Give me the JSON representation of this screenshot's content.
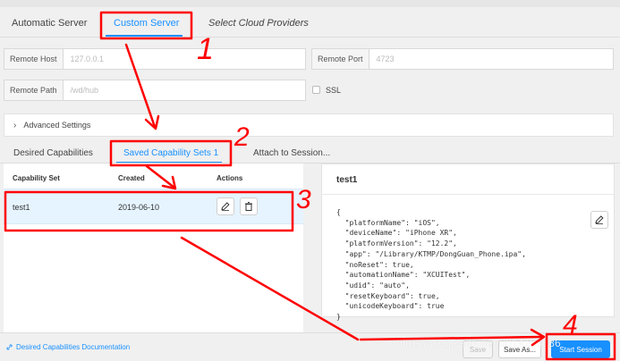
{
  "tabs": [
    {
      "label": "Automatic Server"
    },
    {
      "label": "Custom Server"
    },
    {
      "label": "Select Cloud Providers"
    }
  ],
  "server": {
    "remote_host_label": "Remote Host",
    "remote_host_value": "127.0.0.1",
    "remote_port_label": "Remote Port",
    "remote_port_value": "4723",
    "remote_path_label": "Remote Path",
    "remote_path_value": "/wd/hub",
    "ssl_label": "SSL"
  },
  "advanced": {
    "label": "Advanced Settings"
  },
  "cap_tabs": [
    {
      "label": "Desired Capabilities"
    },
    {
      "label": "Saved Capability Sets 1"
    },
    {
      "label": "Attach to Session..."
    }
  ],
  "table": {
    "headers": [
      "Capability Set",
      "Created",
      "Actions"
    ],
    "rows": [
      {
        "name": "test1",
        "created": "2019-06-10"
      }
    ]
  },
  "detail": {
    "title": "test1",
    "json": "{\n  \"platformName\": \"iOS\",\n  \"deviceName\": \"iPhone XR\",\n  \"platformVersion\": \"12.2\",\n  \"app\": \"/Library/KTMP/DongGuan_Phone.ipa\",\n  \"noReset\": true,\n  \"automationName\": \"XCUITest\",\n  \"udid\": \"auto\",\n  \"resetKeyboard\": true,\n  \"unicodeKeyboard\": true\n}"
  },
  "footer": {
    "doc_link": "Desired Capabilities Documentation",
    "save": "Save",
    "save_as": "Save As...",
    "start_session": "Start Session"
  },
  "watermark": "https://blog.csdn.net/u014103086",
  "annotations": {
    "n1": "1",
    "n2": "2",
    "n3": "3",
    "n4": "4"
  },
  "colors": {
    "accent": "#1890ff",
    "annotation": "#ff0000",
    "row_selected": "#e6f4ff"
  },
  "icons": [
    "pencil-icon",
    "trash-icon",
    "chevron-right-icon",
    "link-icon"
  ]
}
